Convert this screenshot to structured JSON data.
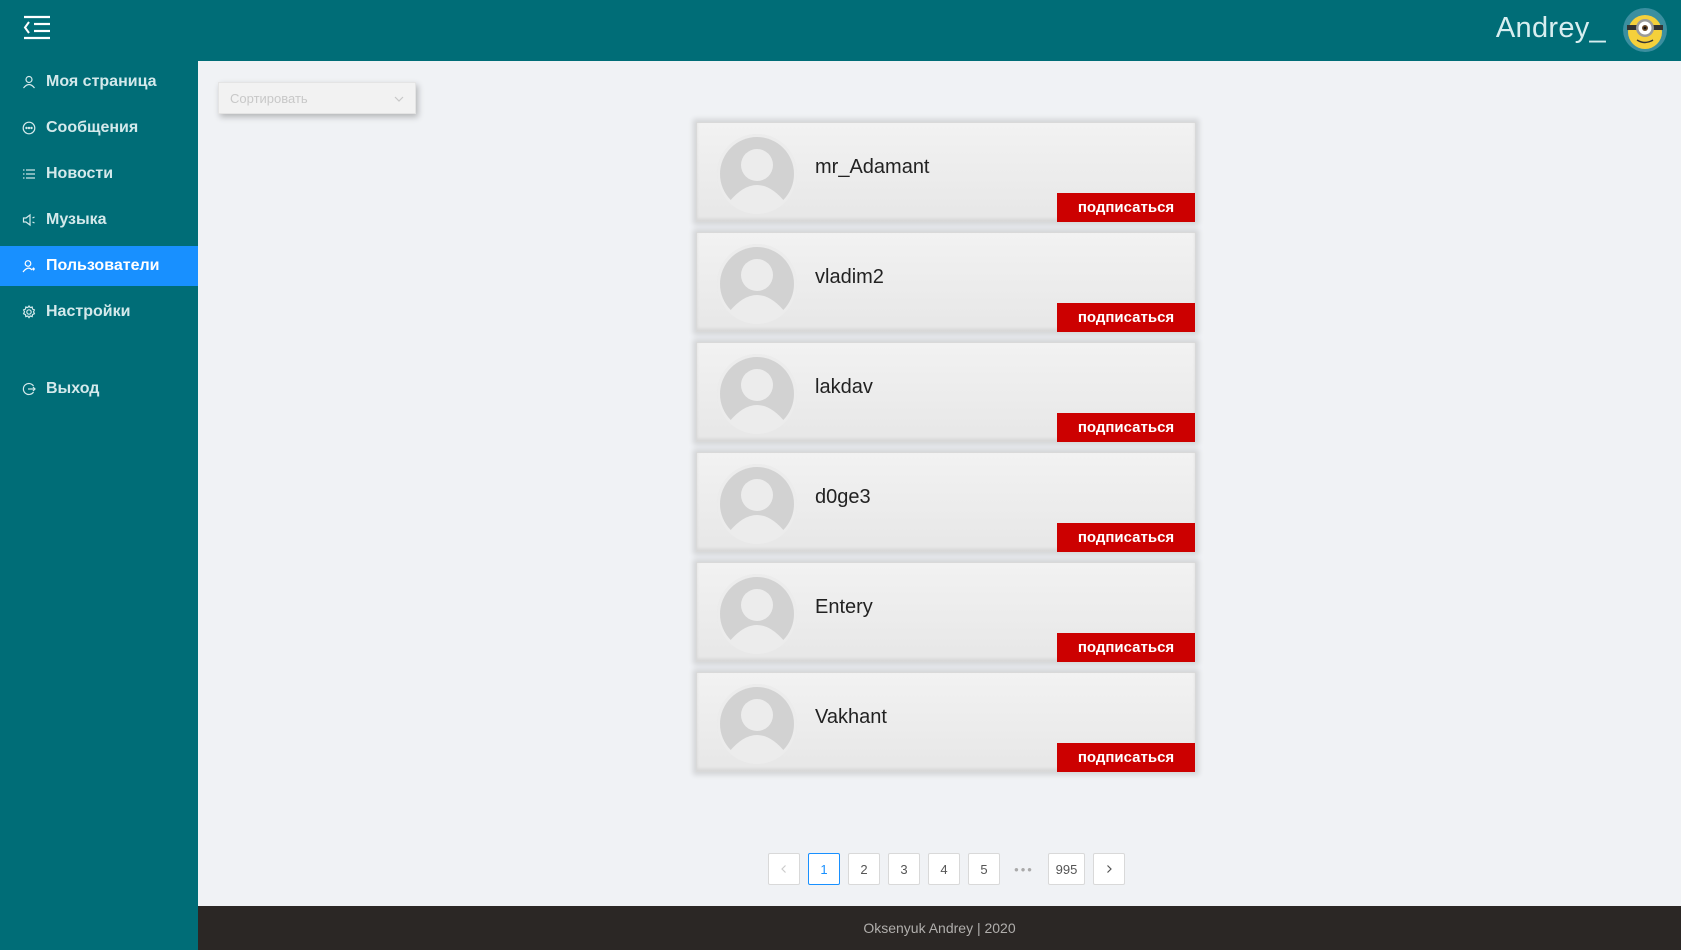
{
  "header": {
    "username": "Andrey_",
    "menu_icon": "menu-fold-icon",
    "avatar_icon": "minion-avatar"
  },
  "sidebar": {
    "items": [
      {
        "label": "Моя страница",
        "icon": "user-icon",
        "active": false
      },
      {
        "label": "Сообщения",
        "icon": "message-icon",
        "active": false
      },
      {
        "label": "Новости",
        "icon": "list-icon",
        "active": false
      },
      {
        "label": "Музыка",
        "icon": "sound-icon",
        "active": false
      },
      {
        "label": "Пользователи",
        "icon": "users-icon",
        "active": true
      },
      {
        "label": "Настройки",
        "icon": "gear-icon",
        "active": false
      },
      {
        "label": "Выход",
        "icon": "logout-icon",
        "active": false
      }
    ]
  },
  "sort": {
    "placeholder": "Сортировать"
  },
  "users": [
    {
      "name": "mr_Adamant",
      "button": "подписаться"
    },
    {
      "name": "vladim2",
      "button": "подписаться"
    },
    {
      "name": "lakdav",
      "button": "подписаться"
    },
    {
      "name": "d0ge3",
      "button": "подписаться"
    },
    {
      "name": "Entery",
      "button": "подписаться"
    },
    {
      "name": "Vakhant",
      "button": "подписаться"
    }
  ],
  "pagination": {
    "pages": [
      "1",
      "2",
      "3",
      "4",
      "5"
    ],
    "ellipsis": "•••",
    "last": "995",
    "current": "1"
  },
  "footer": {
    "text": "Oksenyuk Andrey | 2020"
  },
  "colors": {
    "header_bg": "#006d77",
    "active_item": "#1890ff",
    "follow_button": "#cc0000",
    "footer_bg": "#2b2725"
  }
}
